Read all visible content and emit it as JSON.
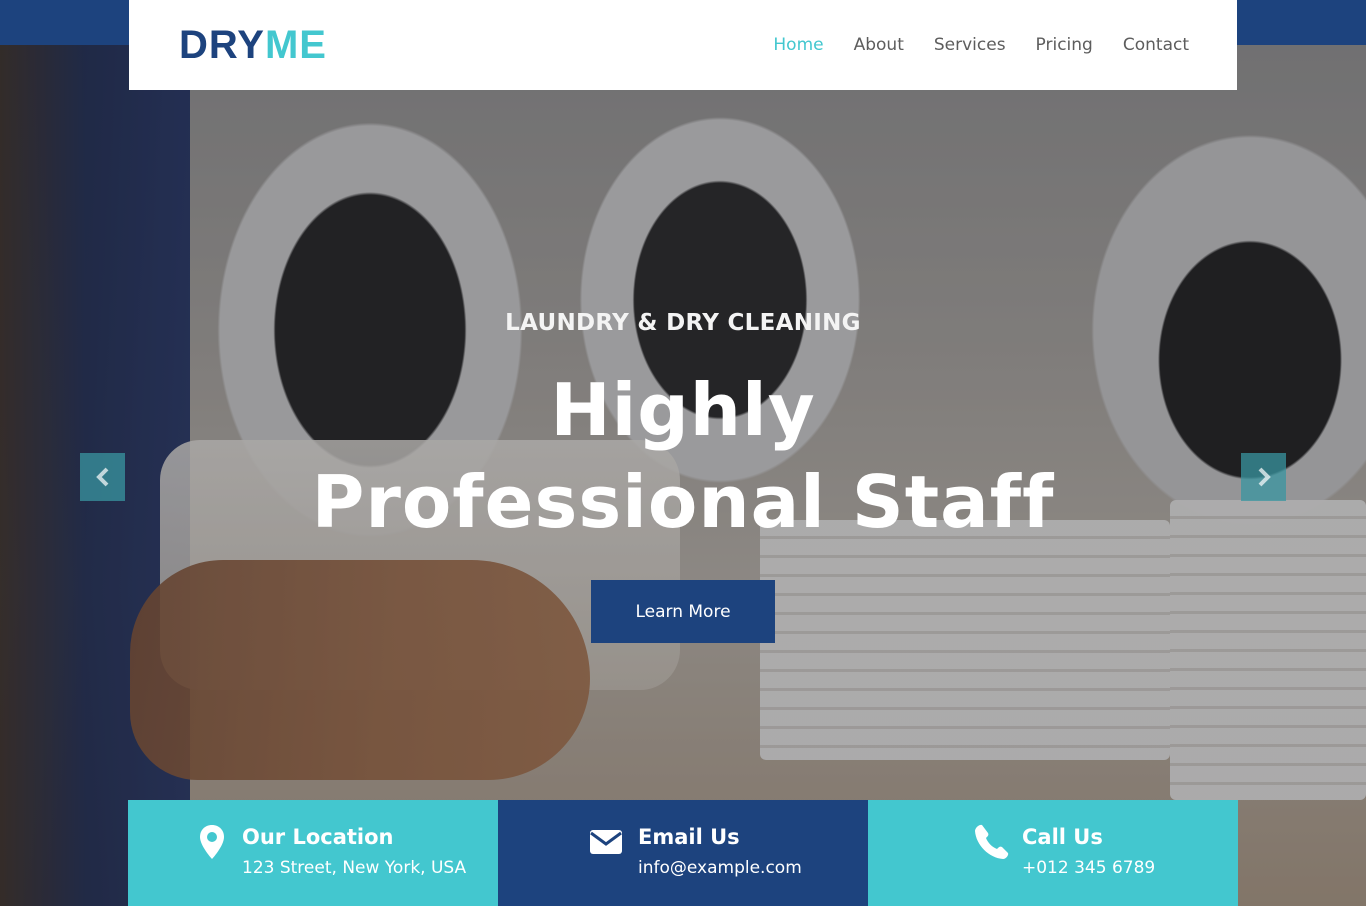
{
  "brand": {
    "logo_part1": "DRY",
    "logo_part2": "ME",
    "color_navy": "#1d437e",
    "color_cyan": "#43c7cf"
  },
  "nav": {
    "items": [
      {
        "label": "Home",
        "active": true
      },
      {
        "label": "About",
        "active": false
      },
      {
        "label": "Services",
        "active": false
      },
      {
        "label": "Pricing",
        "active": false
      },
      {
        "label": "Contact",
        "active": false
      }
    ]
  },
  "hero": {
    "subtitle": "LAUNDRY & DRY CLEANING",
    "title": "Highly Professional Staff",
    "button_label": "Learn More",
    "prev_icon": "chevron-left-icon",
    "next_icon": "chevron-right-icon"
  },
  "info": [
    {
      "icon": "map-pin-icon",
      "title": "Our Location",
      "text": "123 Street, New York, USA"
    },
    {
      "icon": "envelope-icon",
      "title": "Email Us",
      "text": "info@example.com"
    },
    {
      "icon": "phone-icon",
      "title": "Call Us",
      "text": "+012 345 6789"
    }
  ]
}
